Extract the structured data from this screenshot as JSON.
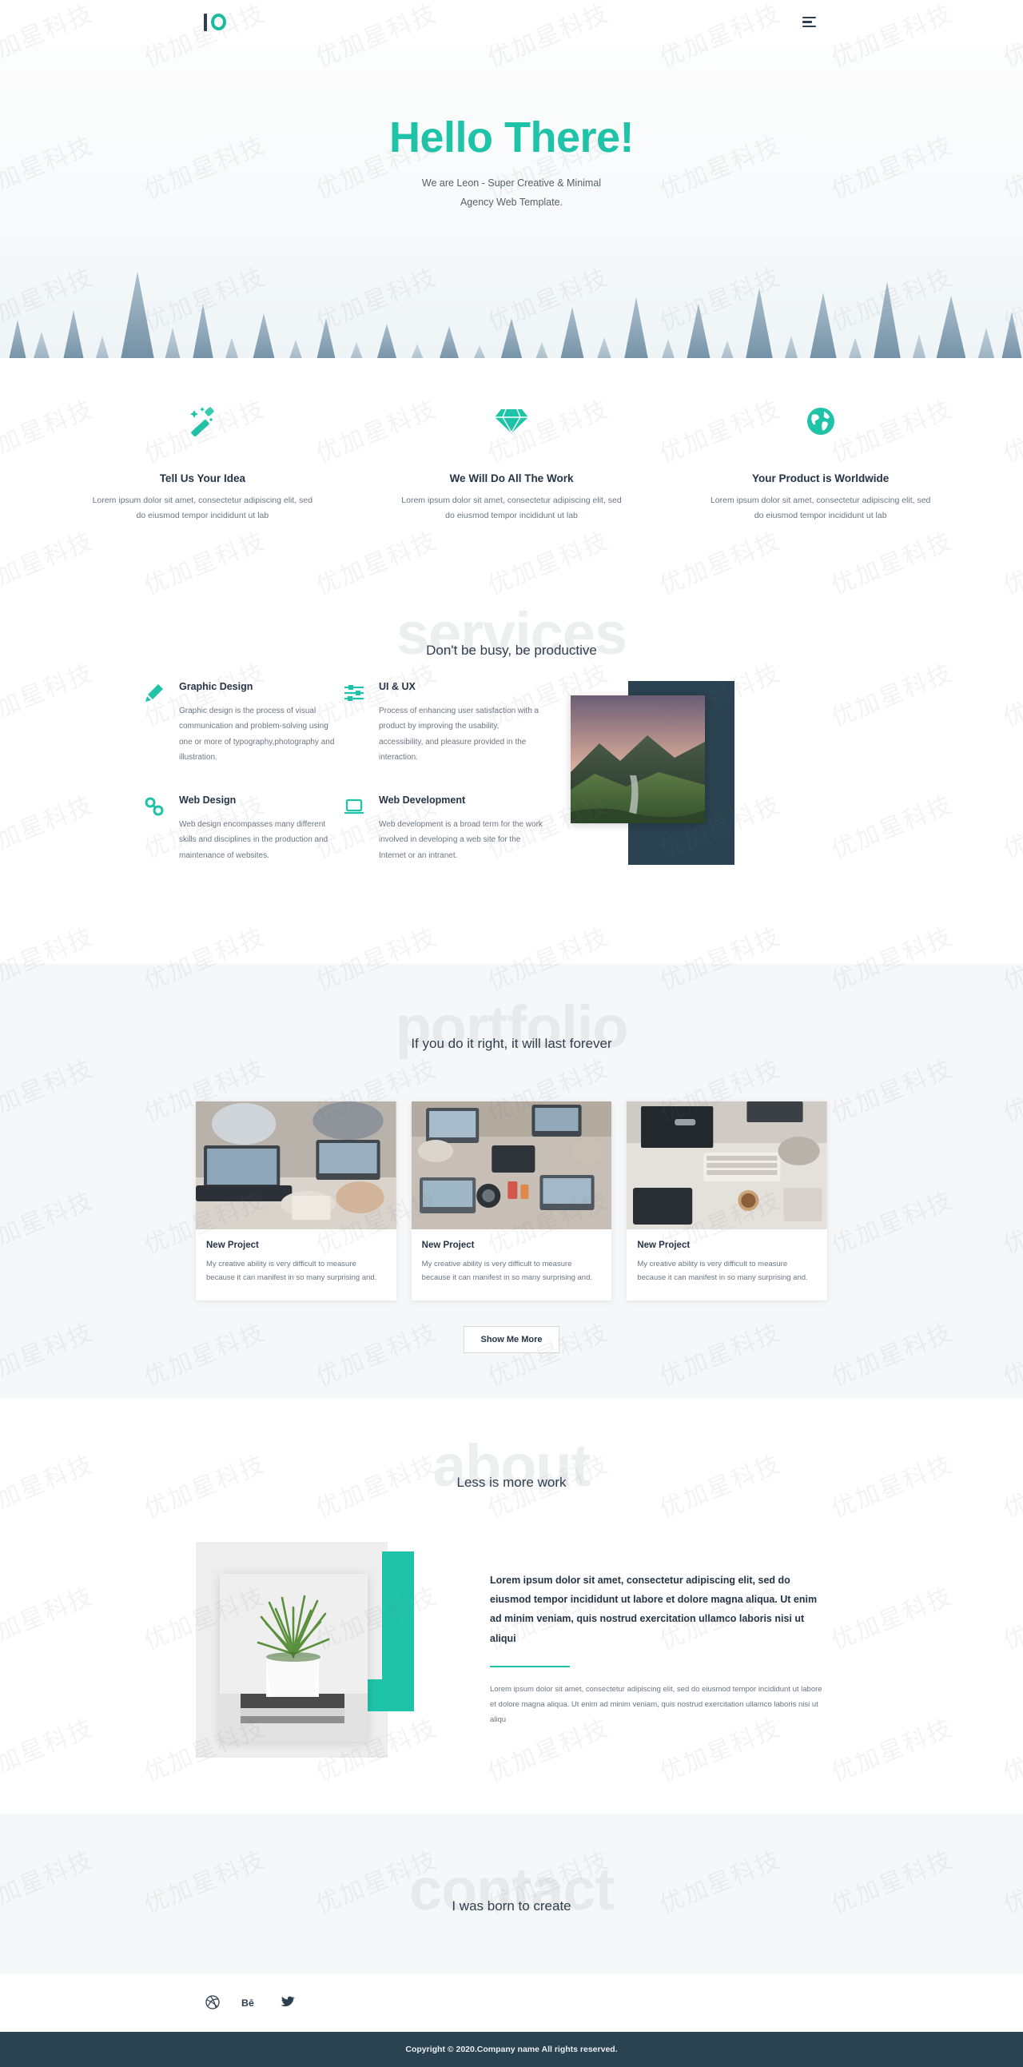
{
  "brand": {
    "accent": "#1fc4a8",
    "navy": "#2b4250",
    "logo_name": "leon-logo"
  },
  "header": {
    "menu_icon": "hamburger-menu-icon",
    "logo_icon": "leon-logo-icon"
  },
  "hero": {
    "title": "Hello There!",
    "subtitle_line1": "We are Leon - Super Creative & Minimal",
    "subtitle_line2": "Agency Web Template."
  },
  "features": [
    {
      "icon": "magic-wand-icon",
      "title": "Tell Us Your Idea",
      "text": "Lorem ipsum dolor sit amet, consectetur adipiscing elit, sed do eiusmod tempor incididunt ut lab"
    },
    {
      "icon": "diamond-icon",
      "title": "We Will Do All The Work",
      "text": "Lorem ipsum dolor sit amet, consectetur adipiscing elit, sed do eiusmod tempor incididunt ut lab"
    },
    {
      "icon": "globe-icon",
      "title": "Your Product is Worldwide",
      "text": "Lorem ipsum dolor sit amet, consectetur adipiscing elit, sed do eiusmod tempor incididunt ut lab"
    }
  ],
  "services": {
    "ghost": "services",
    "subtitle": "Don't be busy, be productive",
    "items": [
      {
        "icon": "pencil-icon",
        "title": "Graphic Design",
        "text": "Graphic design is the process of visual communication and problem-solving using one or more of typography,photography and illustration."
      },
      {
        "icon": "sliders-icon",
        "title": "UI & UX",
        "text": "Process of enhancing user satisfaction with a product by improving the usability, accessibility, and pleasure provided in the interaction."
      },
      {
        "icon": "link-icon",
        "title": "Web Design",
        "text": "Web design encompasses many different skills and disciplines in the production and maintenance of websites."
      },
      {
        "icon": "laptop-icon",
        "title": "Web Development",
        "text": "Web development is a broad term for the work involved in developing a web site for the Internet or an intranet."
      }
    ],
    "image_alt": "mountain-landscape-photo"
  },
  "portfolio": {
    "ghost": "portfolio",
    "subtitle": "If you do it right, it will last forever",
    "cards": [
      {
        "image": "team-laptops-photo",
        "title": "New Project",
        "text": "My creative ability is very difficult to measure because it can manifest in so many surprising and."
      },
      {
        "image": "desk-overhead-photo",
        "title": "New Project",
        "text": "My creative ability is very difficult to measure because it can manifest in so many surprising and."
      },
      {
        "image": "keyboard-desk-photo",
        "title": "New Project",
        "text": "My creative ability is very difficult to measure because it can manifest in so many surprising and."
      }
    ],
    "button_label": "Show Me More"
  },
  "about": {
    "ghost": "about",
    "subtitle": "Less is more work",
    "image_alt": "potted-plant-photo",
    "lead": "Lorem ipsum dolor sit amet, consectetur adipiscing elit, sed do eiusmod tempor incididunt ut labore et dolore magna aliqua. Ut enim ad minim veniam, quis nostrud exercitation ullamco laboris nisi ut aliqui",
    "body": "Lorem ipsum dolor sit amet, consectetur adipiscing elit, sed do eiusmod tempor incididunt ut labore et dolore magna aliqua. Ut enim ad minim veniam, quis nostrud exercitation ullamco laboris nisi ut aliqu"
  },
  "contact": {
    "ghost": "contact",
    "subtitle": "I was born to create",
    "socials": [
      {
        "name": "dribbble-icon",
        "glyph": "dribbble"
      },
      {
        "name": "behance-icon",
        "glyph": "Bē"
      },
      {
        "name": "twitter-icon",
        "glyph": "twitter"
      }
    ]
  },
  "footer": {
    "copyright": "Copyright © 2020.Company name All rights reserved."
  },
  "watermarks": {
    "text": "优加星科技"
  }
}
